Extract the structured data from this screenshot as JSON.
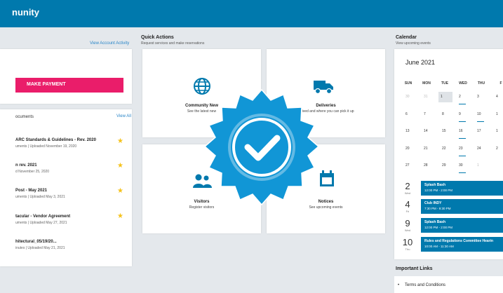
{
  "header": {
    "brand": "nunity",
    "color": "#0079ad"
  },
  "account": {
    "view_activity": "View Account Activity",
    "pay_button": "MAKE PAYMENT"
  },
  "documents": {
    "title": "ocuments",
    "view_all": "View All",
    "items": [
      {
        "title": "ARC Standards & Guidelines - Rev. 2020",
        "sub": "uments | Uploaded November 19, 2020",
        "starred": true
      },
      {
        "title": "n rev. 2021",
        "sub": "d November 25, 2020",
        "starred": true
      },
      {
        "title": "Post - May 2021",
        "sub": "uments | Uploaded May 3, 2021",
        "starred": true
      },
      {
        "title": "tacular - Vendor Agreement",
        "sub": "uments | Uploaded May 27, 2021",
        "starred": true
      },
      {
        "title": "hitectural_05/19/20...",
        "sub": "inutes | Uploaded May 21, 2021",
        "starred": false
      }
    ]
  },
  "quick_actions": {
    "title": "Quick Actions",
    "subtitle": "Request services and make reservations",
    "tiles": [
      {
        "name": "Community New",
        "desc": "See the latest new",
        "icon": "globe-icon"
      },
      {
        "name": "Deliveries",
        "desc": "arrived and where you can pick it up",
        "icon": "truck-icon"
      },
      {
        "name": "Visitors",
        "desc": "Register visitors",
        "icon": "people-icon"
      },
      {
        "name": "Notices",
        "desc": "See upcoming events",
        "icon": "calendar-icon"
      }
    ]
  },
  "calendar": {
    "title": "Calendar",
    "subtitle": "View upcoming events",
    "month": "June 2021",
    "dow": [
      "SUN",
      "MON",
      "TUE",
      "WED",
      "THU",
      "F"
    ],
    "weeks": [
      [
        "30",
        "31",
        "1",
        "2",
        "3",
        "4"
      ],
      [
        "6",
        "7",
        "8",
        "9",
        "10",
        "1"
      ],
      [
        "13",
        "14",
        "15",
        "16",
        "17",
        "1"
      ],
      [
        "20",
        "21",
        "22",
        "23",
        "24",
        "2"
      ],
      [
        "27",
        "28",
        "29",
        "30",
        "1",
        ""
      ]
    ],
    "events": [
      {
        "day": "2",
        "dow": "Wed",
        "title": "Splash Bash",
        "time": "12:00 PM - 2:00 PM"
      },
      {
        "day": "4",
        "dow": "Fri",
        "title": "Club INDY",
        "time": "7:30 PM - 9:30 PM"
      },
      {
        "day": "9",
        "dow": "Wed",
        "title": "Splash Bash",
        "time": "12:00 PM - 2:00 PM"
      },
      {
        "day": "10",
        "dow": "Thu",
        "title": "Rules and Regulations Committee Hearin",
        "time": "10:00 AM - 11:30 AM"
      }
    ]
  },
  "important_links": {
    "title": "Important Links",
    "items": [
      "Terms and Conditions"
    ]
  },
  "overlay": {
    "icon": "verified-badge-icon",
    "color": "#1196d6"
  }
}
